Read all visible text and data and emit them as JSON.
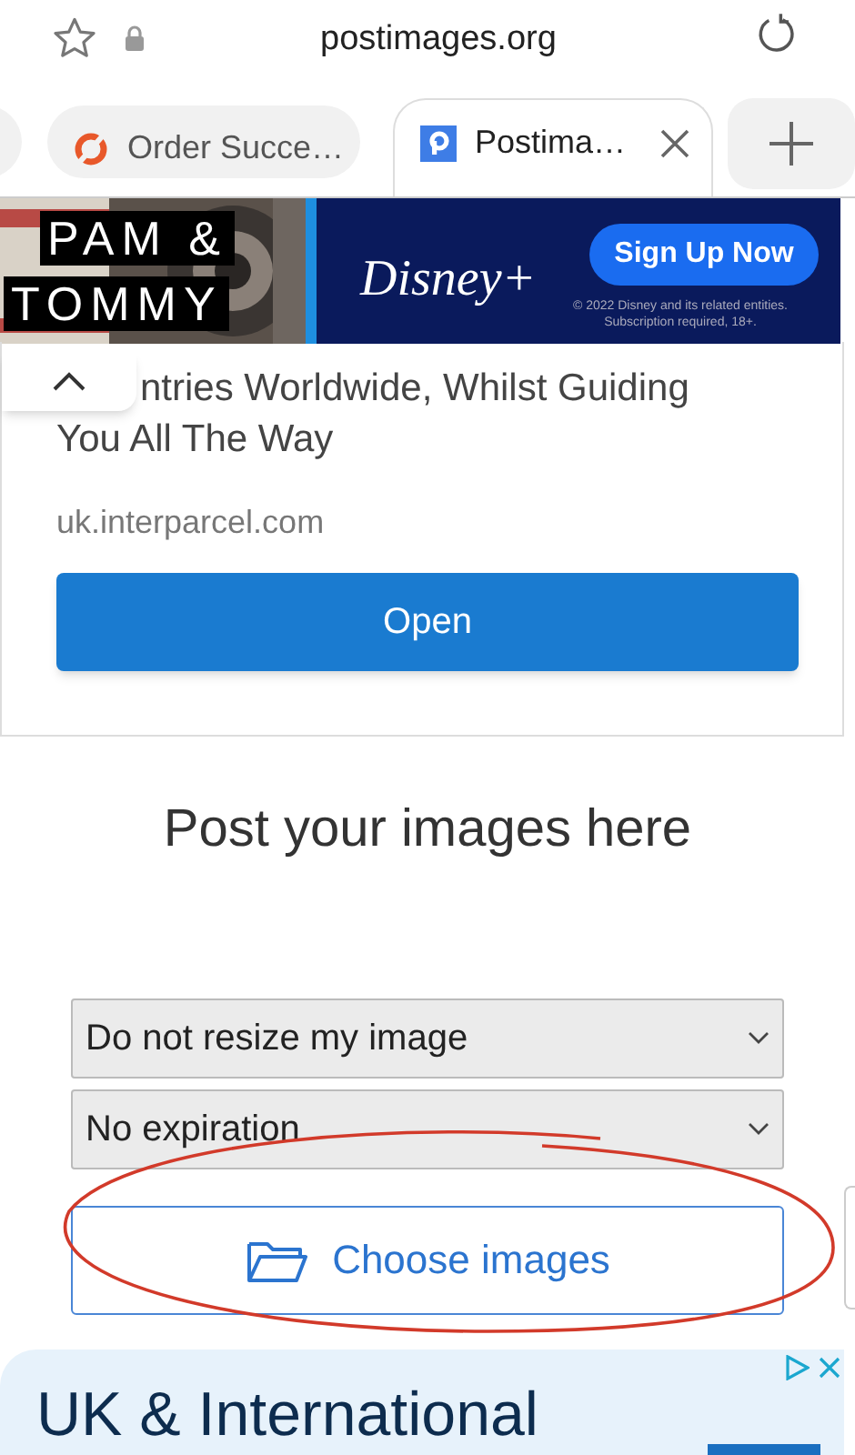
{
  "address_bar": {
    "url": "postimages.org"
  },
  "tabs": [
    {
      "title": "Order Succe…",
      "selected": false
    },
    {
      "title": "Postima…",
      "selected": true
    }
  ],
  "top_ad": {
    "title_line_1": "PAM &",
    "title_line_2": "TOMMY",
    "brand": "Disney+",
    "button": "Sign Up Now",
    "legal_1": "© 2022 Disney and its related entities.",
    "legal_2": "Subscription required, 18+."
  },
  "ad_card": {
    "text_line_1": "ntries Worldwide, Whilst Guiding",
    "text_line_2": "You All The Way",
    "domain": "uk.interparcel.com",
    "button": "Open"
  },
  "heading": "Post your images here",
  "selects": [
    {
      "value": "Do not resize my image"
    },
    {
      "value": "No expiration"
    }
  ],
  "upload_button": "Choose images",
  "bottom_ad": {
    "headline": "UK & International"
  }
}
